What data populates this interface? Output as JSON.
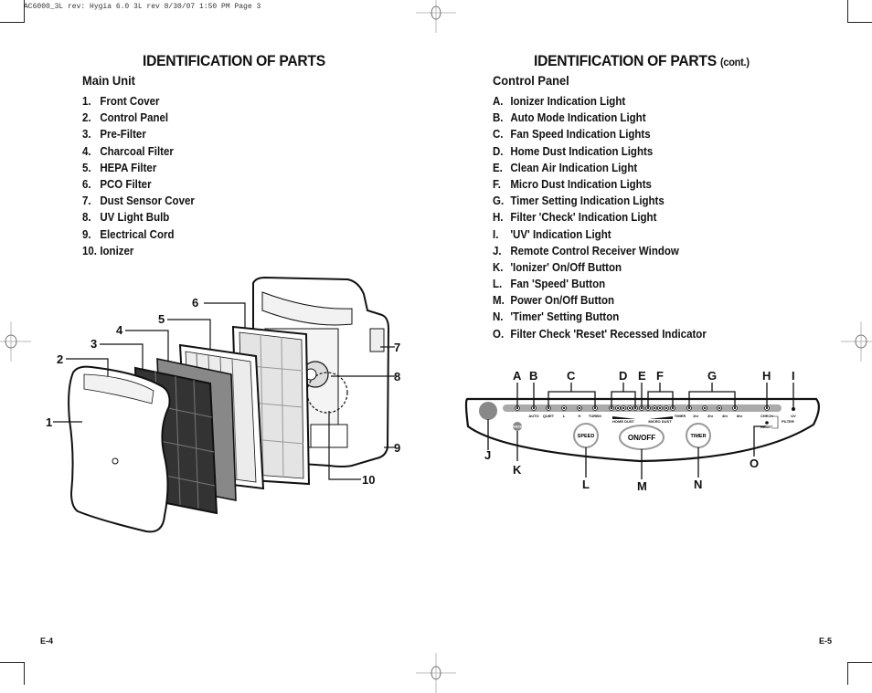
{
  "slug_line": "AC6000_3L rev: Hygia 6.0 3L rev  8/30/07  1:50 PM  Page 3",
  "left_page": {
    "title": "IDENTIFICATION OF PARTS",
    "subtitle": "Main Unit",
    "items": [
      {
        "num": "1.",
        "label": "Front Cover"
      },
      {
        "num": "2.",
        "label": "Control Panel"
      },
      {
        "num": "3.",
        "label": "Pre-Filter"
      },
      {
        "num": "4.",
        "label": "Charcoal Filter"
      },
      {
        "num": "5.",
        "label": "HEPA Filter"
      },
      {
        "num": "6.",
        "label": "PCO Filter"
      },
      {
        "num": "7.",
        "label": "Dust Sensor Cover"
      },
      {
        "num": "8.",
        "label": "UV Light Bulb"
      },
      {
        "num": "9.",
        "label": "Electrical Cord"
      },
      {
        "num": "10.",
        "label": "Ionizer"
      }
    ],
    "callouts": [
      "1",
      "2",
      "3",
      "4",
      "5",
      "6",
      "7",
      "8",
      "9",
      "10"
    ],
    "page_number": "E-4"
  },
  "right_page": {
    "title": "IDENTIFICATION OF PARTS",
    "title_suffix": "(cont.)",
    "subtitle": "Control Panel",
    "items": [
      {
        "num": "A.",
        "label": "Ionizer Indication Light"
      },
      {
        "num": "B.",
        "label": "Auto Mode Indication Light"
      },
      {
        "num": "C.",
        "label": "Fan Speed Indication Lights"
      },
      {
        "num": "D.",
        "label": "Home Dust Indication Lights"
      },
      {
        "num": "E.",
        "label": "Clean Air Indication Light"
      },
      {
        "num": "F.",
        "label": "Micro Dust Indication Lights"
      },
      {
        "num": "G.",
        "label": "Timer Setting Indication Lights"
      },
      {
        "num": "H.",
        "label": "Filter 'Check' Indication Light"
      },
      {
        "num": "I.",
        "label": "'UV' Indication Light"
      },
      {
        "num": "J.",
        "label": "Remote Control Receiver Window"
      },
      {
        "num": "K.",
        "label": "'Ionizer' On/Off Button"
      },
      {
        "num": "L.",
        "label": "Fan 'Speed' Button"
      },
      {
        "num": "M.",
        "label": "Power On/Off Button"
      },
      {
        "num": "N.",
        "label": "'Timer' Setting Button"
      },
      {
        "num": "O.",
        "label": "Filter Check 'Reset' Recessed Indicator"
      }
    ],
    "panel": {
      "callouts": {
        "A": "A",
        "B": "B",
        "C": "C",
        "D": "D",
        "E": "E",
        "F": "F",
        "G": "G",
        "H": "H",
        "I": "I",
        "J": "J",
        "K": "K",
        "L": "L",
        "M": "M",
        "N": "N",
        "O": "O"
      },
      "labels": {
        "auto": "AUTO",
        "quiet": "QUIET",
        "low": "L",
        "high": "H",
        "turbo": "TURBO",
        "home_dust": "HOME DUST",
        "micro_dust": "MICRO DUST",
        "timer": "TIMER",
        "t1": "1hr",
        "t2": "2hr",
        "t4": "4hr",
        "t8": "8hr",
        "check": "CHECK",
        "uv": "UV",
        "filter": "FILTER",
        "reset": "RESET",
        "ionizer": "IONIZER"
      },
      "buttons": {
        "speed": "SPEED",
        "power": "ON/OFF",
        "timer": "TIMER"
      }
    },
    "page_number": "E-5"
  }
}
